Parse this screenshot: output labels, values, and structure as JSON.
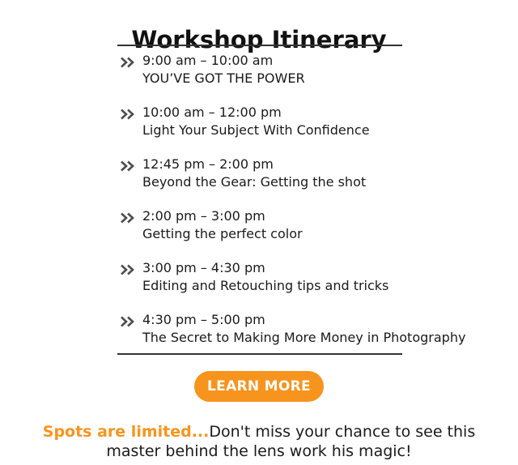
{
  "header": {
    "title": "Workshop Itinerary"
  },
  "itinerary": {
    "items": [
      {
        "time": "9:00 am – 10:00 am",
        "title": "YOU’VE GOT THE POWER"
      },
      {
        "time": "10:00 am – 12:00 pm",
        "title": "Light Your Subject With Confidence"
      },
      {
        "time": "12:45 pm – 2:00 pm",
        "title": "Beyond the Gear: Getting the shot"
      },
      {
        "time": "2:00 pm – 3:00 pm",
        "title": "Getting the perfect color"
      },
      {
        "time": "3:00 pm – 4:30 pm",
        "title": "Editing and Retouching tips and tricks"
      },
      {
        "time": "4:30 pm – 5:00 pm",
        "title": "The Secret to Making More Money in Photography"
      }
    ],
    "bullet_icon": "double-chevron-right-icon"
  },
  "cta_button": {
    "label": "LEARN MORE"
  },
  "footer": {
    "highlight": "Spots are limited...",
    "line1": "Don't miss your chance to see this",
    "line2": "master behind the lens work his magic!"
  },
  "colors": {
    "accent": "#f7941d",
    "text": "#1a1a1a",
    "rule": "#333333",
    "chevron": "#4d4d4d"
  }
}
